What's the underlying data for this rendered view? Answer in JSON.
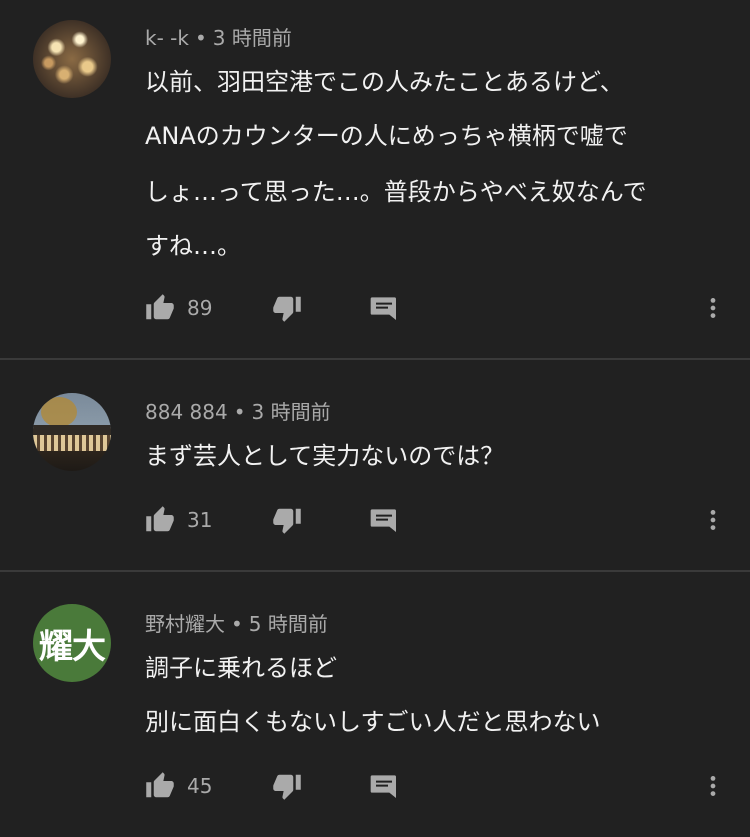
{
  "comments": [
    {
      "author": "k- -k",
      "time": "3 時間前",
      "lines": [
        "以前、羽田空港でこの人みたことあるけど、",
        "ANAのカウンターの人にめっちゃ横柄で嘘で",
        "しょ…って思った…。普段からやべえ奴なんで",
        "すね…。"
      ],
      "likes": "89",
      "avatar_icon": "avatar-photo-lights"
    },
    {
      "author": "884 884",
      "time": "3 時間前",
      "lines": [
        "まず芸人として実力ないのでは？"
      ],
      "likes": "31",
      "avatar_icon": "avatar-photo-building"
    },
    {
      "author": "野村耀大",
      "time": "5 時間前",
      "lines": [
        "調子に乗れるほど",
        "別に面白くもないしすごい人だと思わない"
      ],
      "likes": "45",
      "avatar_text": "耀大",
      "avatar_color": "#4a7a3a"
    }
  ],
  "separator": "•",
  "colors": {
    "background": "#212121",
    "text": "#f1f1f1",
    "meta": "#aaaaaa",
    "divider": "#3a3a3a"
  }
}
